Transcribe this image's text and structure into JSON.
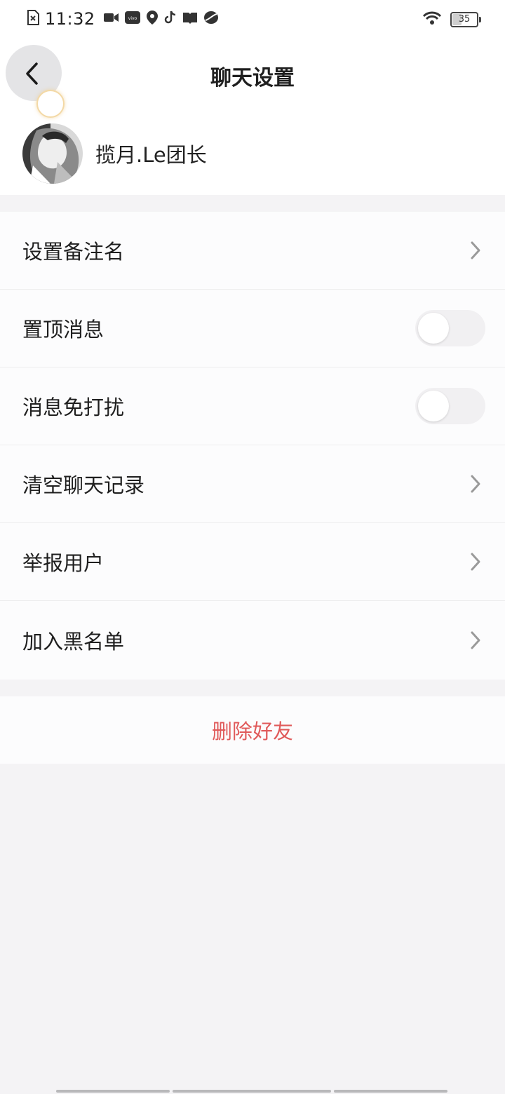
{
  "status_bar": {
    "time": "11:32",
    "icons_left": [
      "sim-error-icon",
      "video-icon",
      "vivo-icon",
      "location-icon",
      "tiktok-icon",
      "book-icon",
      "ball-icon"
    ],
    "icons_right": [
      "wifi-icon",
      "battery-icon"
    ],
    "battery_level": "35"
  },
  "header": {
    "title": "聊天设置",
    "back_icon": "chevron-left-icon"
  },
  "profile": {
    "name": "揽月.Le团长"
  },
  "settings": [
    {
      "label": "设置备注名",
      "control": "chevron"
    },
    {
      "label": "置顶消息",
      "control": "toggle",
      "on": false
    },
    {
      "label": "消息免打扰",
      "control": "toggle",
      "on": false
    },
    {
      "label": "清空聊天记录",
      "control": "chevron"
    },
    {
      "label": "举报用户",
      "control": "chevron"
    },
    {
      "label": "加入黑名单",
      "control": "chevron"
    }
  ],
  "danger_action": {
    "label": "删除好友",
    "color": "#e05a5a"
  }
}
